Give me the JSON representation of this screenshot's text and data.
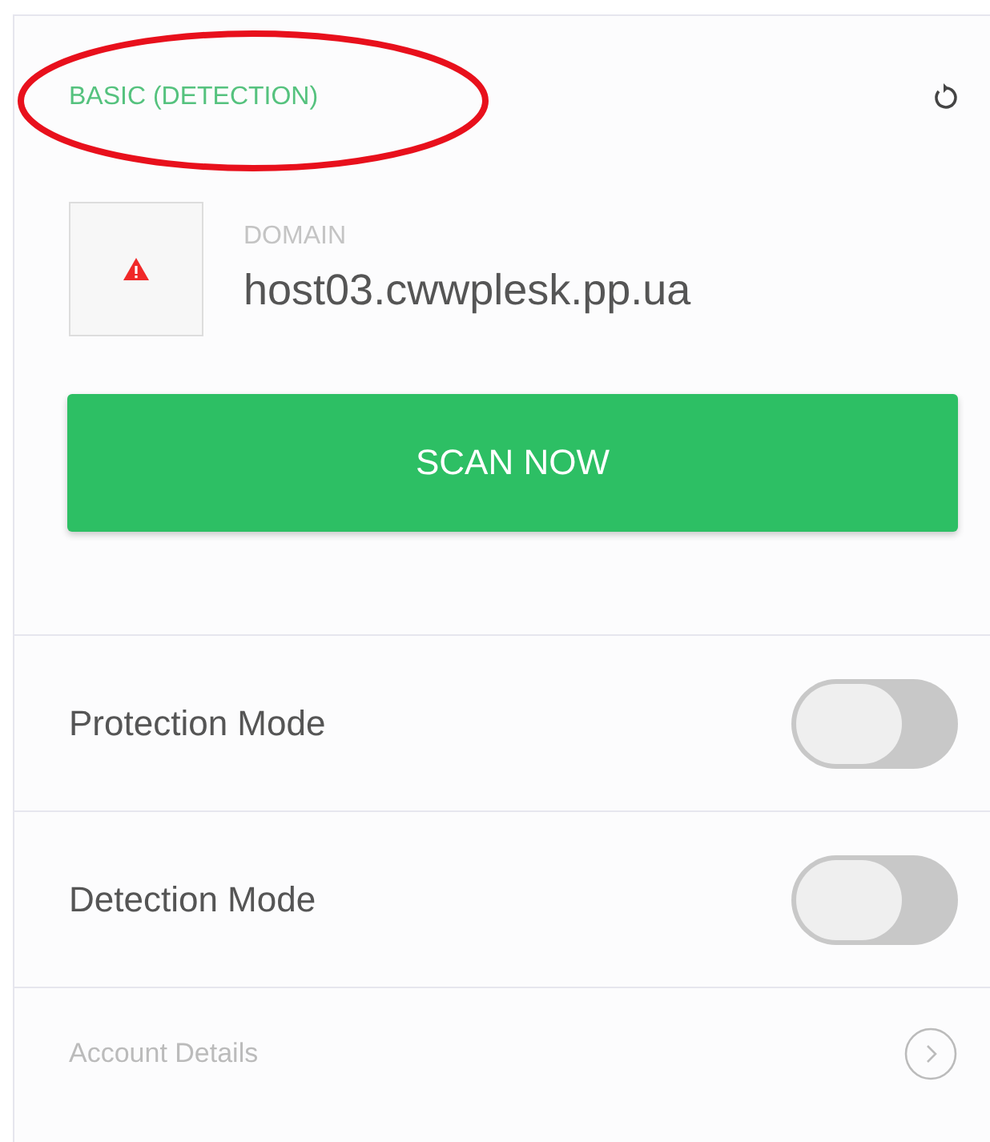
{
  "header": {
    "title": "BASIC (DETECTION)",
    "title_circled": true
  },
  "domain": {
    "label": "DOMAIN",
    "value": "host03.cwwplesk.pp.ua",
    "warning": true
  },
  "scan_button": {
    "label": "SCAN NOW"
  },
  "modes": [
    {
      "label": "Protection Mode",
      "on": false
    },
    {
      "label": "Detection Mode",
      "on": false
    }
  ],
  "account_link": {
    "label": "Account Details"
  }
}
